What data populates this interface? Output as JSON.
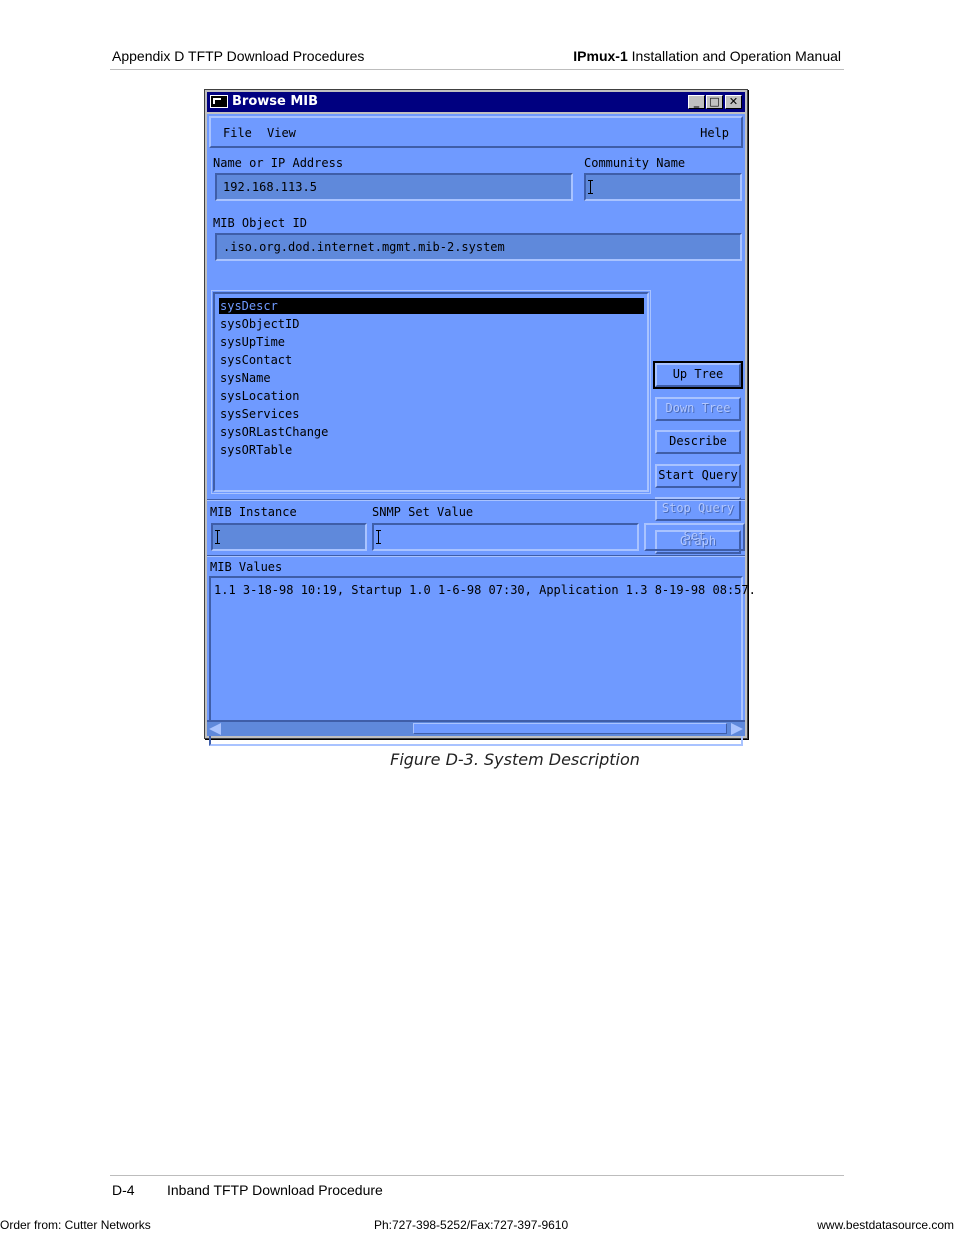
{
  "page_header": {
    "left": "Appendix D  TFTP Download Procedures",
    "right_bold": "IPmux-1",
    "right_rest": " Installation and Operation Manual"
  },
  "window": {
    "title": "Browse MIB",
    "title_icon": "terminal-icon",
    "controls": {
      "minimize": "_",
      "maximize": "□",
      "close": "✕"
    },
    "menu": {
      "file": "File",
      "view": "View",
      "help": "Help"
    },
    "name_or_ip_label": "Name or IP Address",
    "name_or_ip_value": "192.168.113.5",
    "community_label": "Community Name",
    "community_value": "",
    "mib_object_id_label": "MIB Object ID",
    "mib_object_id_value": ".iso.org.dod.internet.mgmt.mib-2.system",
    "mib_list": {
      "selected_index": 0,
      "items": [
        "sysDescr",
        "sysObjectID",
        "sysUpTime",
        "sysContact",
        "sysName",
        "sysLocation",
        "sysServices",
        "sysORLastChange",
        "sysORTable"
      ]
    },
    "buttons": {
      "up_tree": "Up Tree",
      "down_tree": "Down Tree",
      "describe": "Describe",
      "start_query": "Start Query",
      "stop_query": "Stop Query",
      "graph": "Graph"
    },
    "mib_instance_label": "MIB Instance",
    "mib_instance_value": "",
    "snmp_set_label": "SNMP Set Value",
    "snmp_set_value": "",
    "set_button": "Set",
    "mib_values_label": "MIB Values",
    "mib_values_text": "1.1 3-18-98 10:19, Startup 1.0 1-6-98 07:30, Application 1.3 8-19-98 08:57."
  },
  "caption": "Figure D-3.  System Description",
  "page_footer": {
    "page_number": "D-4",
    "section": "Inband TFTP Download Procedure",
    "order_from": "Order from: Cutter Networks",
    "phone_fax": "Ph:727-398-5252/Fax:727-397-9610",
    "website": "www.bestdatasource.com"
  }
}
